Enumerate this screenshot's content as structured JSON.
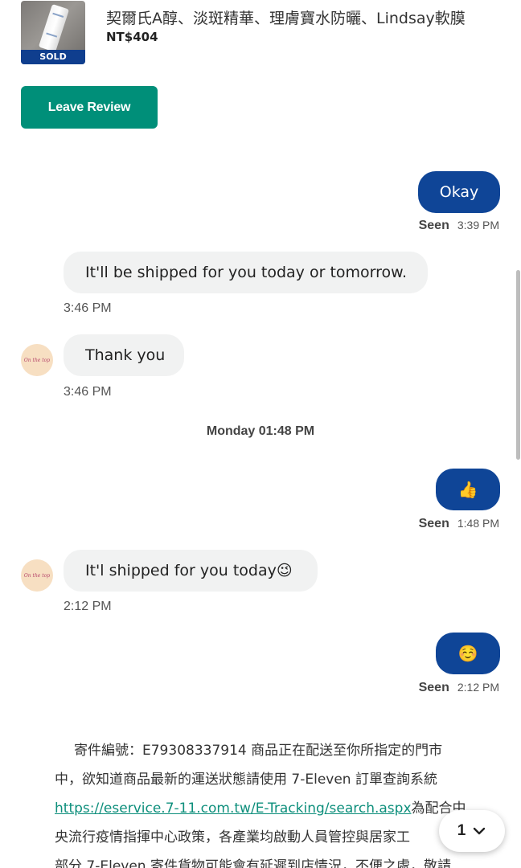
{
  "product": {
    "title": "契爾氏A醇、淡斑精華、理膚寶水防曬、Lindsay軟膜",
    "price": "NT$404",
    "badge": "SOLD"
  },
  "actions": {
    "leave_review": "Leave Review"
  },
  "messages": [
    {
      "direction": "out",
      "text": "Okay",
      "status": "Seen",
      "time": "3:39 PM"
    },
    {
      "direction": "in",
      "text": "It'll be shipped for you today or tomorrow.",
      "time": "3:46 PM"
    },
    {
      "direction": "in",
      "text": "Thank you",
      "time": "3:46 PM",
      "avatar": "On the top"
    },
    {
      "direction": "out",
      "text": "👍",
      "status": "Seen",
      "time": "1:48 PM"
    },
    {
      "direction": "in",
      "text": "It'l shipped for you today😉",
      "time": "2:12 PM",
      "avatar": "On the top"
    },
    {
      "direction": "out",
      "text": "☺️",
      "status": "Seen",
      "time": "2:12 PM"
    }
  ],
  "date_separator": "Monday 01:48 PM",
  "last_message": {
    "line1": "寄件編號：E79308337914 商品正在配送至你所指定的門市",
    "line2": "中，欲知道商品最新的運送狀態請使用 7-Eleven 訂單查詢系統",
    "link": "https://eservice.7-11.com.tw/E-Tracking/search.aspx",
    "line3_after_link": "為配合中",
    "line4": "央流行疫情指揮中心政策，各產業均啟動人員管控與居家工",
    "line5": "部分 7-Eleven 寄件貨物可能會有延遲到店情況，不便之處，敬請"
  },
  "pager": {
    "count": "1",
    "icon": "chevron-down-icon"
  }
}
